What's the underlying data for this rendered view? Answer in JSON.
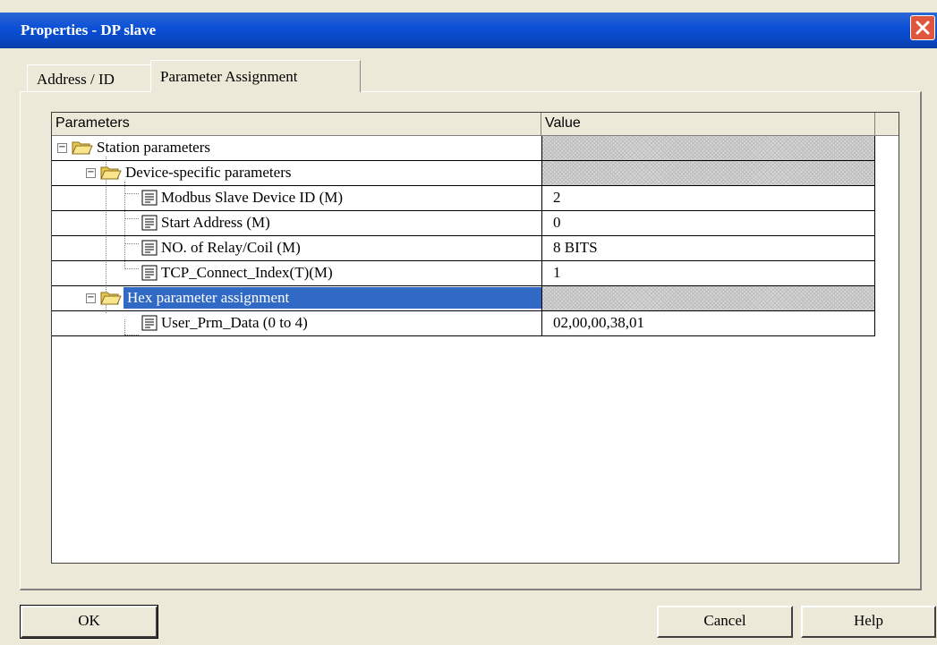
{
  "window": {
    "title": "Properties - DP slave"
  },
  "tabs": [
    {
      "label": "Address / ID",
      "active": false
    },
    {
      "label": "Parameter Assignment",
      "active": true
    }
  ],
  "grid": {
    "columns": [
      "Parameters",
      "Value"
    ],
    "rows": [
      {
        "label": "Station parameters",
        "value": "",
        "type": "folder",
        "expanded": true,
        "level": 0
      },
      {
        "label": "Device-specific parameters",
        "value": "",
        "type": "folder",
        "expanded": true,
        "level": 1
      },
      {
        "label": "Modbus Slave Device ID (M)",
        "value": "2",
        "type": "param",
        "level": 2
      },
      {
        "label": "Start Address (M)",
        "value": "0",
        "type": "param",
        "level": 2
      },
      {
        "label": "NO. of Relay/Coil (M)",
        "value": "8 BITS",
        "type": "param",
        "level": 2
      },
      {
        "label": "TCP_Connect_Index(T)(M)",
        "value": "1",
        "type": "param",
        "level": 2
      },
      {
        "label": "Hex parameter assignment",
        "value": "",
        "type": "folder",
        "expanded": true,
        "level": 1,
        "selected": true
      },
      {
        "label": "User_Prm_Data (0 to 4)",
        "value": "02,00,00,38,01",
        "type": "param",
        "level": 2
      }
    ]
  },
  "buttons": {
    "ok": "OK",
    "cancel": "Cancel",
    "help": "Help"
  },
  "colors": {
    "titlebar": "#0a4fd6",
    "selection": "#316ac5",
    "close": "#e0563d",
    "dialog": "#ece9d8"
  }
}
